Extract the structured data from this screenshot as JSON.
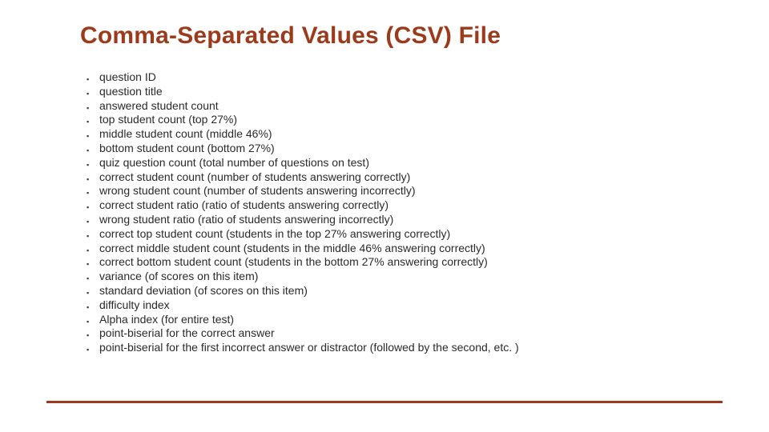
{
  "title": "Comma-Separated Values (CSV) File",
  "items": [
    "question ID",
    "question title",
    "answered student count",
    "top student count (top 27%)",
    "middle student count (middle 46%)",
    "bottom student count (bottom 27%)",
    "quiz question count (total number of questions on test)",
    "correct student count (number of students answering correctly)",
    "wrong student count (number of students answering incorrectly)",
    "correct student ratio (ratio of students answering correctly)",
    "wrong student ratio (ratio of students answering incorrectly)",
    "correct top student count (students in the top 27% answering correctly)",
    "correct middle student count (students in the middle 46% answering correctly)",
    "correct bottom student count (students in the bottom 27% answering correctly)",
    "variance (of scores on this item)",
    "standard deviation (of scores on this item)",
    "difficulty index",
    "Alpha index (for entire test)",
    "point-biserial for the correct answer",
    "point-biserial for the first incorrect answer or distractor (followed by the second, etc. )"
  ],
  "bullet_glyph": "▪",
  "accent_color": "#9c3b1c"
}
